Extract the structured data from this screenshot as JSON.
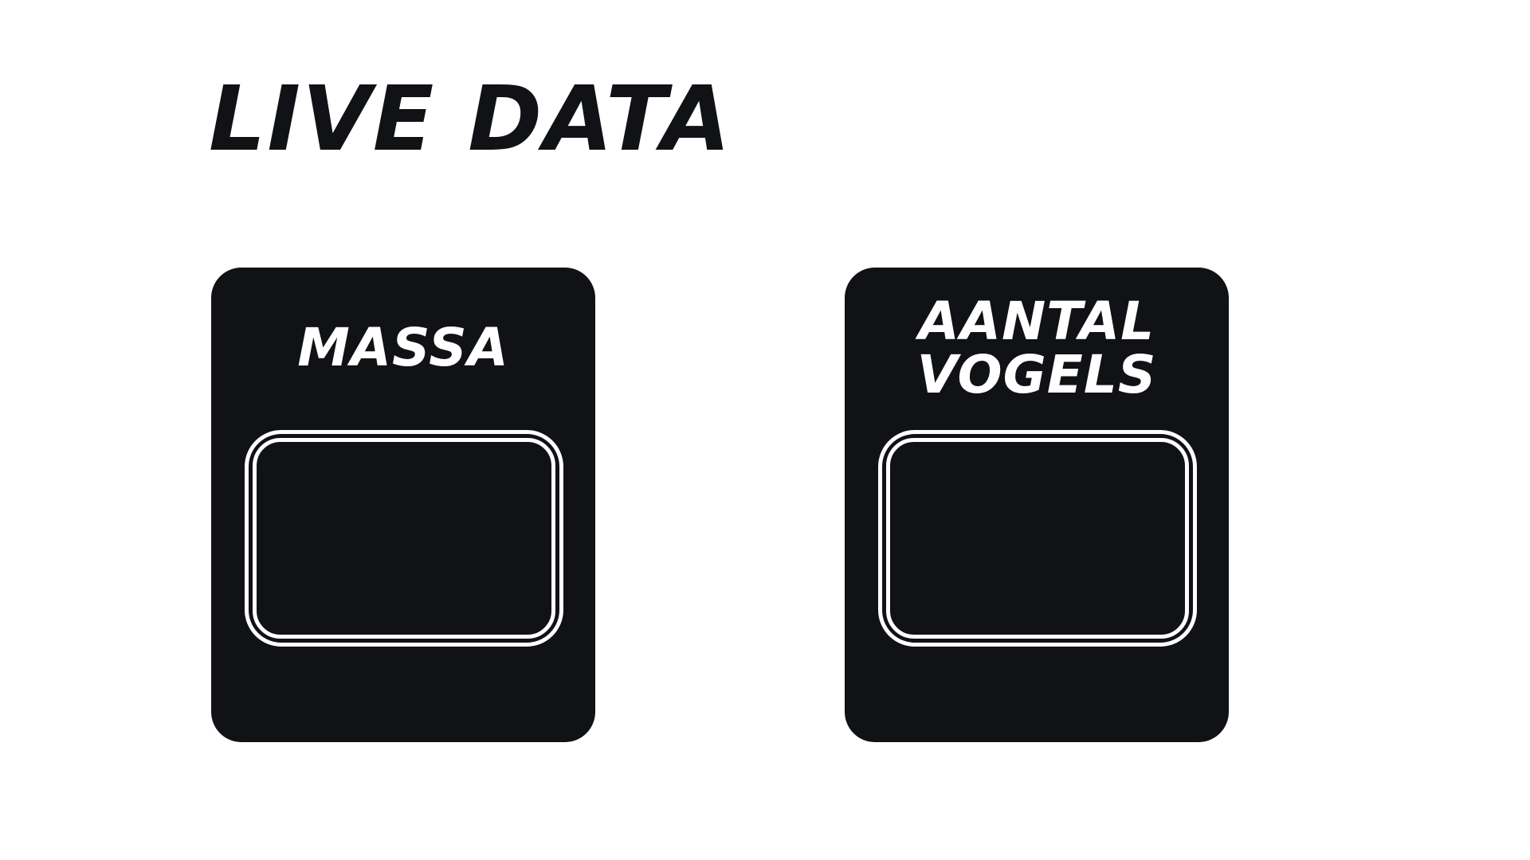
{
  "page": {
    "title": "LIVE DATA"
  },
  "cards": {
    "massa": {
      "label": "MASSA",
      "value": ""
    },
    "vogels": {
      "label_line1": "AANTAL",
      "label_line2": "VOGELS",
      "value": ""
    }
  },
  "colors": {
    "background": "#ffffff",
    "card": "#111215",
    "text_on_card": "#ffffff",
    "title": "#111215"
  }
}
